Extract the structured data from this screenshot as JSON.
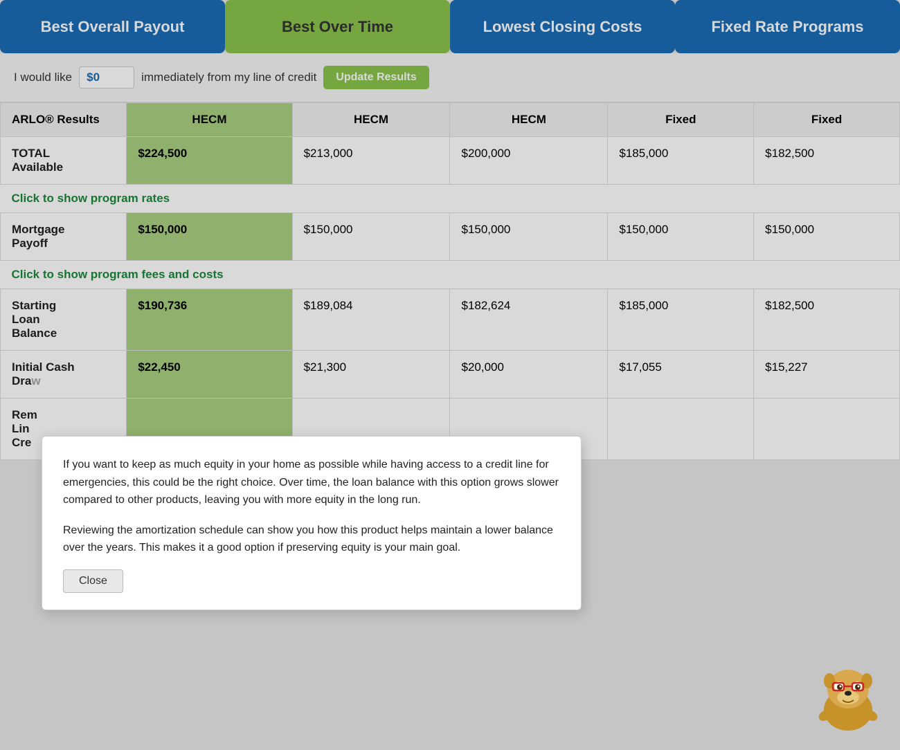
{
  "tabs": [
    {
      "label": "Best Overall Payout",
      "type": "active-blue"
    },
    {
      "label": "Best Over Time",
      "type": "active-green"
    },
    {
      "label": "Lowest Closing Costs",
      "type": "blue"
    },
    {
      "label": "Fixed Rate Programs",
      "type": "blue"
    }
  ],
  "credit_row": {
    "prefix": "I would like",
    "value": "$0",
    "suffix": "immediately from my line of credit",
    "button_label": "Update Results"
  },
  "table": {
    "col_header_first": "ARLO® Results",
    "columns": [
      "HECM",
      "HECM",
      "HECM",
      "Fixed",
      "Fixed"
    ],
    "rows": [
      {
        "label": "TOTAL Available",
        "values": [
          "$224,500",
          "$213,000",
          "$200,000",
          "$185,000",
          "$182,500"
        ],
        "highlight_col": 0
      }
    ],
    "click_rates": "Click to show program rates",
    "mortgage_row": {
      "label": "Mortgage Payoff",
      "values": [
        "$150,000",
        "$150,000",
        "$150,000",
        "$150,000",
        "$150,000"
      ],
      "highlight_col": 0
    },
    "click_fees": "Click to show program fees and costs",
    "loan_balance_row": {
      "label": "Starting Loan Balance",
      "values": [
        "$190,736",
        "$189,084",
        "$182,624",
        "$185,000",
        "$182,500"
      ],
      "highlight_col": 0
    },
    "initial_cash_row": {
      "label": "Initial Cash Dra...",
      "values": [
        "$22,450",
        "$21,300",
        "$20,000",
        "$17,055",
        "$15,227"
      ],
      "highlight_col": 0
    },
    "remaining_row": {
      "label": "Remaining Line of Cre...",
      "values": [
        "",
        "",
        "",
        "",
        ""
      ],
      "highlight_col": 0
    }
  },
  "popup": {
    "paragraph1": "If you want to keep as much equity in your home as possible while having access to a credit line for emergencies, this could be the right choice. Over time, the loan balance with this option grows slower compared to other products, leaving you with more equity in the long run.",
    "paragraph2": "Reviewing the amortization schedule can show you how this product helps maintain a lower balance over the years. This makes it a good option if preserving equity is your main goal.",
    "close_label": "Close"
  }
}
